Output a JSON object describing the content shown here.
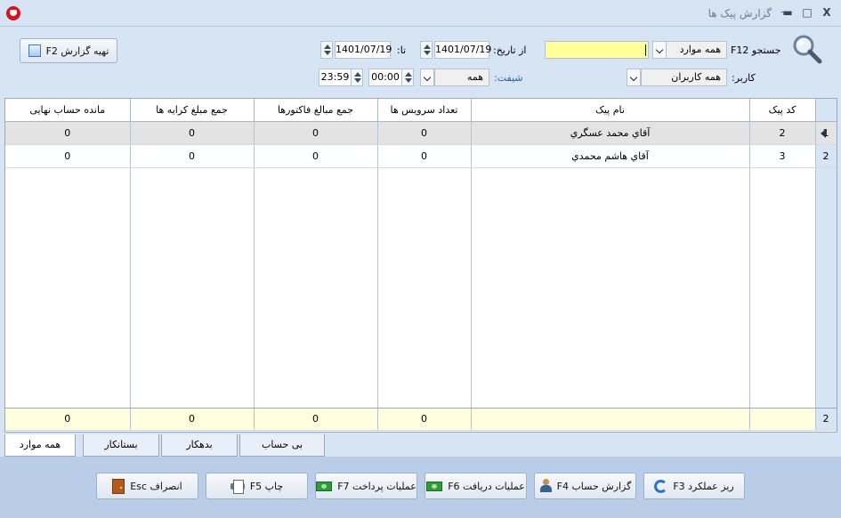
{
  "window": {
    "title": "گزارش پیک ها",
    "dash": "–",
    "minimize_glyph": "▬",
    "maximize_glyph": "□",
    "close_glyph": "X"
  },
  "filters": {
    "prepare_report_label": "تهیه گزارش F2",
    "search_label": "جستجو F12",
    "search_scope": "همه موارد",
    "from_date_label": "از تاریخ:",
    "from_date": "1401/07/19",
    "to_date_label": "تا:",
    "to_date": "1401/07/19",
    "user_label": "کاربر:",
    "user_value": "همه کاربران",
    "shift_label": "شیفت:",
    "shift_value": "همه",
    "from_time": "00:00",
    "to_time": "23:59"
  },
  "table": {
    "columns": [
      "کد پیک",
      "نام پیک",
      "تعداد سرویس ها",
      "جمع مبالغ فاکتورها",
      "جمع مبلغ کرایه ها",
      "مانده حساب نهایی"
    ],
    "rows": [
      {
        "num": "1",
        "code": "2",
        "name": "آقاي محمد عسگري",
        "services": "0",
        "invoices": "0",
        "fares": "0",
        "balance": "0"
      },
      {
        "num": "2",
        "code": "3",
        "name": "آقاي هاشم محمدي",
        "services": "0",
        "invoices": "0",
        "fares": "0",
        "balance": "0"
      }
    ],
    "totals": {
      "num": "2",
      "services": "0",
      "invoices": "0",
      "fares": "0",
      "balance": "0"
    }
  },
  "tabs": [
    "همه موارد",
    "بستانکار",
    "بدهکار",
    "بی حساب"
  ],
  "actions": {
    "details": "ریز عملکرد F3",
    "account_report": "گزارش حساب F4",
    "receipts": "عملیات دریافت F6",
    "payments": "عملیات پرداخت F7",
    "print": "چاپ F5",
    "cancel": "انصراف Esc"
  },
  "colors": {
    "search_highlight": "#ffff99",
    "selected_row": "#e3e3e3",
    "totals_row": "#ffffe0",
    "bottom_bar": "#b9cde8"
  }
}
